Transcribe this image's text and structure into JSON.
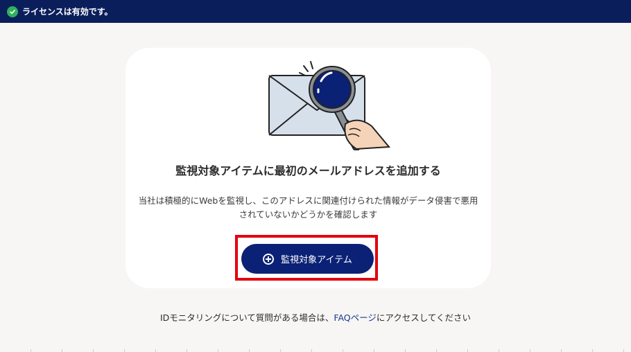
{
  "topbar": {
    "status_text": "ライセンスは有効です。",
    "status_icon": "check-circle-icon",
    "bg_color": "#0b1e5c"
  },
  "card": {
    "illustration": "envelope-magnifier-illustration",
    "headline": "監視対象アイテムに最初のメールアドレスを追加する",
    "description_line1": "当社は積極的にWebを監視し、このアドレスに関連付けられた情報がデータ侵害で悪用",
    "description_line2": "されていないかどうかを確認します",
    "button_label": "監視対象アイテム",
    "button_icon": "plus-circle-icon",
    "button_color": "#0b2175",
    "highlight_color": "#e3000f"
  },
  "footer": {
    "text_before": "IDモニタリングについて質問がある場合は、",
    "link_text": "FAQページ",
    "text_after": "にアクセスしてください"
  }
}
